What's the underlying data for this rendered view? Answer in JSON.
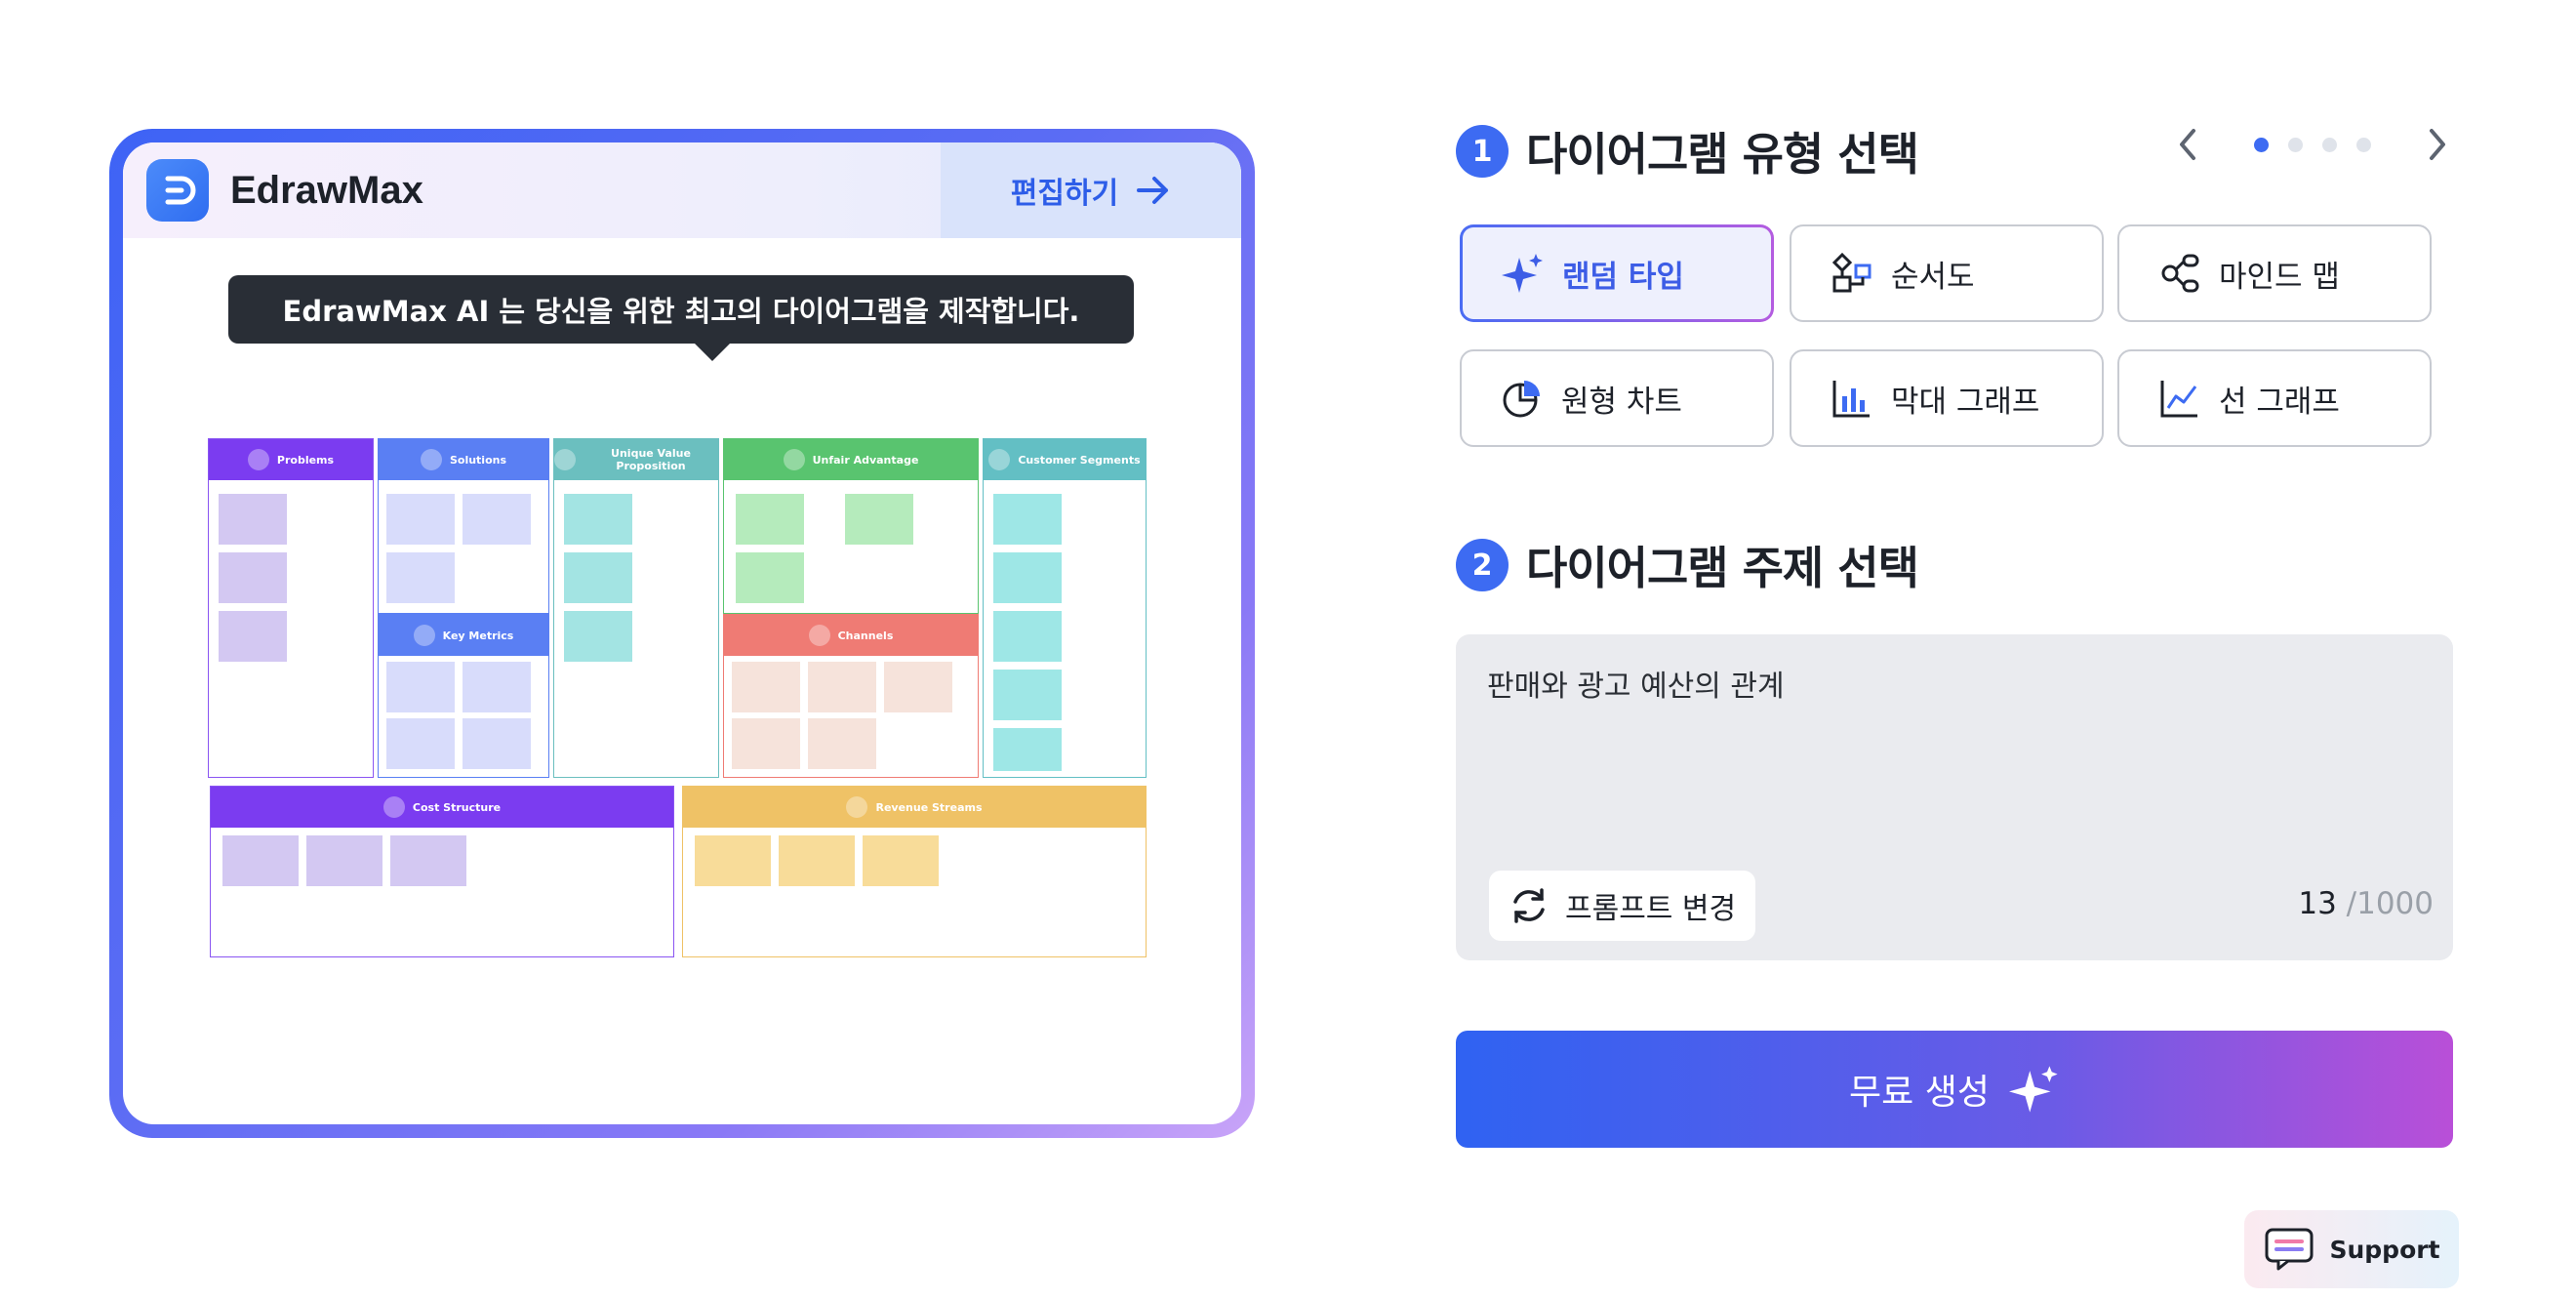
{
  "preview": {
    "brand_name": "EdrawMax",
    "edit_label": "편집하기",
    "tooltip": "EdrawMax AI 는 당신을 위한 최고의 다이어그램을 제작합니다.",
    "canvas": {
      "problems": "Problems",
      "solutions": "Solutions",
      "uvp": "Unique Value Proposition",
      "unfair": "Unfair Advantage",
      "segments": "Customer Segments",
      "metrics": "Key Metrics",
      "channels": "Channels",
      "cost": "Cost Structure",
      "revenue": "Revenue Streams"
    }
  },
  "step1": {
    "number": "1",
    "title": "다이어그램 유형 선택",
    "types": [
      {
        "label": "랜덤 타입",
        "icon": "sparkle-icon"
      },
      {
        "label": "순서도",
        "icon": "flowchart-icon"
      },
      {
        "label": "마인드 맵",
        "icon": "mindmap-icon"
      },
      {
        "label": "원형 차트",
        "icon": "pie-chart-icon"
      },
      {
        "label": "막대 그래프",
        "icon": "bar-chart-icon"
      },
      {
        "label": "선 그래프",
        "icon": "line-chart-icon"
      }
    ]
  },
  "step2": {
    "number": "2",
    "title": "다이어그램 주제 선택",
    "topic": "판매와 광고 예산의 관계",
    "prompt_change": "프롬프트 변경",
    "count": "13",
    "max": "/1000"
  },
  "generate_label": "무료 생성",
  "support_label": "Support",
  "colors": {
    "accent": "#3d6bf2",
    "problems": "#7b3cf0",
    "solutions": "#5a7ff3",
    "uvp": "#6bbfbf",
    "unfair": "#59c46f",
    "segments": "#63bfc4",
    "channels": "#ef7b74",
    "revenue": "#efc266"
  }
}
